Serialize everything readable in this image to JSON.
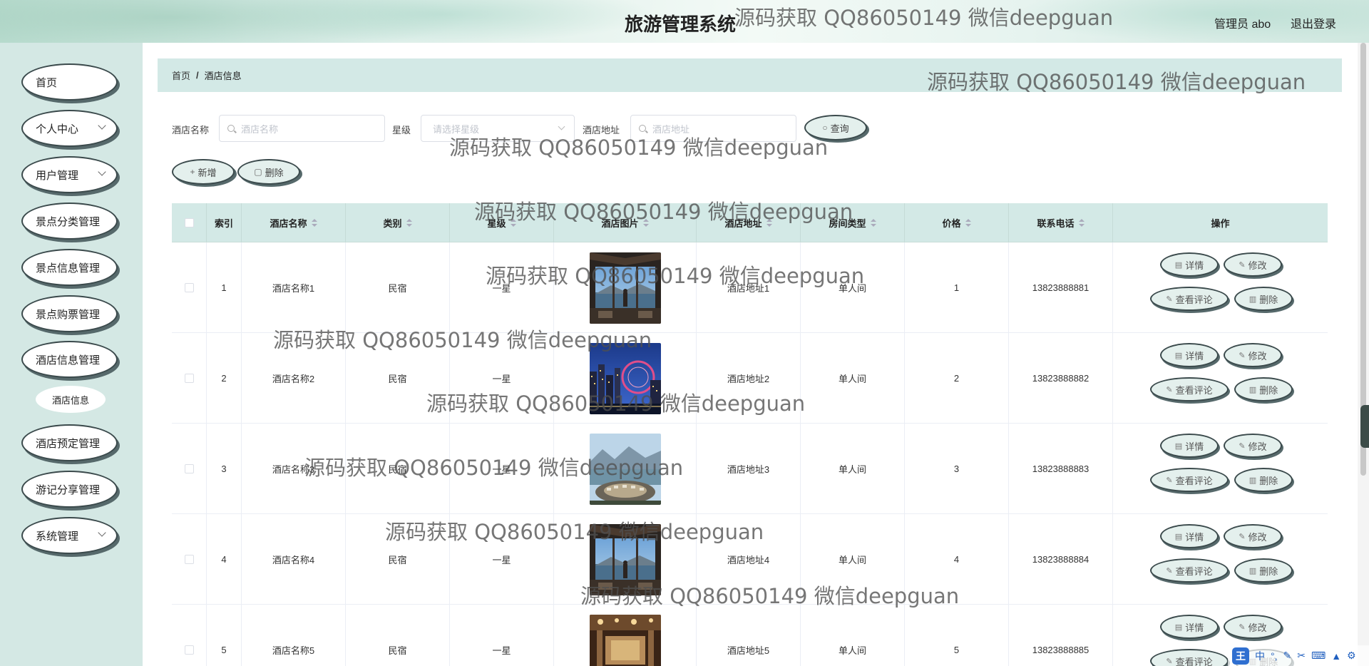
{
  "header": {
    "title": "旅游管理系统",
    "admin": "管理员 abo",
    "logout": "退出登录"
  },
  "sidebar": {
    "items": [
      {
        "label": "首页",
        "has_arrow": false
      },
      {
        "label": "个人中心",
        "has_arrow": true
      },
      {
        "label": "用户管理",
        "has_arrow": true
      },
      {
        "label": "景点分类管理",
        "has_arrow": false
      },
      {
        "label": "景点信息管理",
        "has_arrow": false
      },
      {
        "label": "景点购票管理",
        "has_arrow": false
      },
      {
        "label": "酒店信息管理",
        "has_arrow": false
      },
      {
        "label": "酒店预定管理",
        "has_arrow": false
      },
      {
        "label": "游记分享管理",
        "has_arrow": false
      },
      {
        "label": "系统管理",
        "has_arrow": true
      }
    ],
    "sub_item": "酒店信息"
  },
  "breadcrumb": {
    "home": "首页",
    "separator": "/",
    "current": "酒店信息"
  },
  "search": {
    "name_label": "酒店名称",
    "name_placeholder": "酒店名称",
    "star_label": "星级",
    "star_placeholder": "请选择星级",
    "address_label": "酒店地址",
    "address_placeholder": "酒店地址",
    "query_button": "查询"
  },
  "actions": {
    "add_button": "新增",
    "delete_button": "删除"
  },
  "table": {
    "columns": [
      "索引",
      "酒店名称",
      "类别",
      "星级",
      "酒店图片",
      "酒店地址",
      "房间类型",
      "价格",
      "联系电话",
      "操作"
    ],
    "rows": [
      {
        "index": "1",
        "name": "酒店名称1",
        "category": "民宿",
        "star": "一星",
        "image": "hotel-view-window",
        "address": "酒店地址1",
        "room": "单人间",
        "price": "1",
        "phone": "13823888881"
      },
      {
        "index": "2",
        "name": "酒店名称2",
        "category": "民宿",
        "star": "一星",
        "image": "city-night-ferris-wheel",
        "address": "酒店地址2",
        "room": "单人间",
        "price": "2",
        "phone": "13823888882"
      },
      {
        "index": "3",
        "name": "酒店名称3",
        "category": "民宿",
        "star": "一星",
        "image": "resort-lake-mountains",
        "address": "酒店地址3",
        "room": "单人间",
        "price": "3",
        "phone": "13823888883"
      },
      {
        "index": "4",
        "name": "酒店名称4",
        "category": "民宿",
        "star": "一星",
        "image": "hotel-view-window",
        "address": "酒店地址4",
        "room": "单人间",
        "price": "4",
        "phone": "13823888884"
      },
      {
        "index": "5",
        "name": "酒店名称5",
        "category": "民宿",
        "star": "一星",
        "image": "hotel-lobby",
        "address": "酒店地址5",
        "room": "单人间",
        "price": "5",
        "phone": "13823888885"
      }
    ],
    "ops": {
      "detail": "详情",
      "edit": "修改",
      "review": "查看评论",
      "delete": "删除"
    }
  },
  "watermark": "源码获取 QQ86050149 微信deepguan",
  "ime": {
    "logo": "王",
    "mode": "中"
  },
  "colors": {
    "sidebar_bg": "#d4e8e4",
    "header_bar_bg": "#d3e9e6",
    "button_bg": "#e4f0ed",
    "button_border": "#3b4a4c"
  }
}
